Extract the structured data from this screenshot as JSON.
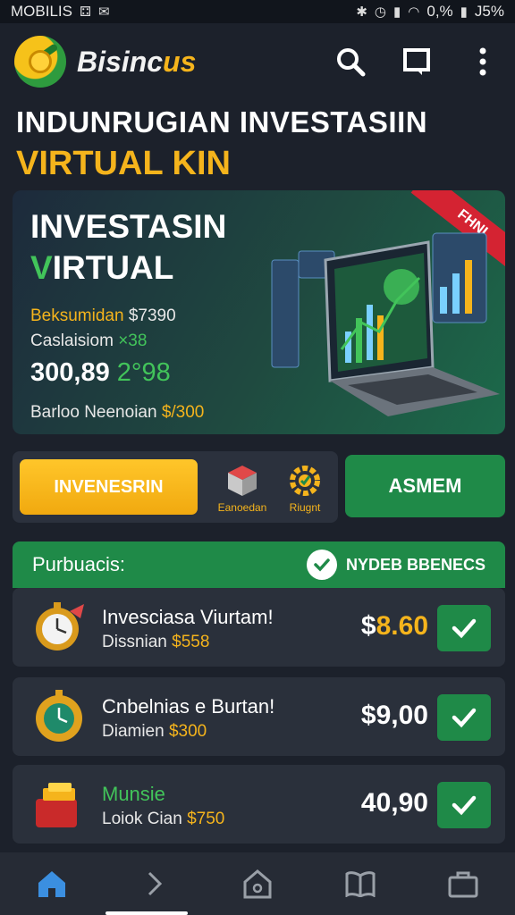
{
  "status_bar": {
    "carrier": "MOBILIS",
    "signal_text": "0,%",
    "battery_text": "J5%"
  },
  "header": {
    "brand_prefix": "Bisinc",
    "brand_suffix": "us",
    "icons": [
      "search-icon",
      "window-icon",
      "more-icon"
    ]
  },
  "page_title": {
    "line1": "INDUNRUGIAN INVESTASIIN",
    "line2": "VIRTUAL KIN"
  },
  "hero": {
    "ribbon": "FHNI",
    "title1": "INVESTASIN",
    "title2_first": "V",
    "title2_rest": "IRTUAL",
    "line1_label": "Beksumidan",
    "line1_value": "$7390",
    "line2_label": "Caslaisiom",
    "line2_value": "×38",
    "big_value": "300,89",
    "big_suffix": "2°98",
    "line4_label": "Barloo Neenoian",
    "line4_value": "$/300"
  },
  "actions": {
    "invest_label": "INVENESRIN",
    "tool1_label": "Eanoedan",
    "tool2_label": "Riugnt",
    "asmem_label": "ASMEM"
  },
  "section": {
    "title": "Purbuacis:",
    "badge": "NYDEB BBENECS"
  },
  "transactions": [
    {
      "name": "Invesciasa Viurtam!",
      "sub_label": "Dissnian",
      "sub_value": "$558",
      "amount": "$8.60",
      "icon": "stopwatch-icon"
    },
    {
      "name": "Cnbelnias e Burtan!",
      "sub_label": "Diamien",
      "sub_value": "$300",
      "amount": "$9,00",
      "icon": "clock-coin-icon"
    },
    {
      "name": "Munsie",
      "sub_label": "Loiok Cian",
      "sub_value": "$750",
      "amount": "40,90",
      "icon": "gold-box-icon"
    }
  ],
  "bottom_nav": [
    "home-icon",
    "chevron-icon",
    "house-outline-icon",
    "book-icon",
    "briefcase-icon"
  ],
  "colors": {
    "accent_gold": "#f5b41c",
    "accent_green": "#1f8a48",
    "background": "#1c212b"
  }
}
